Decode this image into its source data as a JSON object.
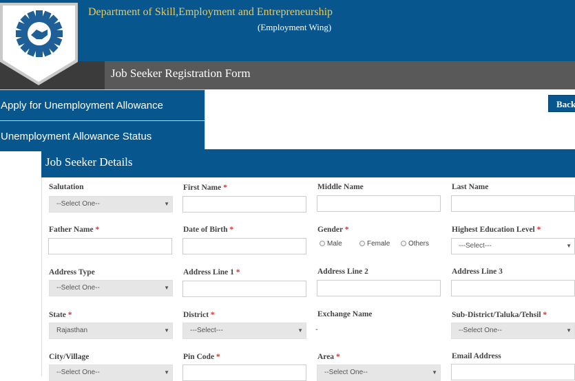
{
  "header": {
    "department": "Department of Skill,Employment and Entrepreneurship",
    "wing": "(Employment Wing)",
    "form_title": "Job Seeker Registration Form",
    "logo_icon": "gear-handshake-logo-icon"
  },
  "menu": {
    "items": [
      {
        "label": "Apply for Unemployment Allowance"
      },
      {
        "label": "Unemployment Allowance Status"
      }
    ]
  },
  "back_button": {
    "label": "Back"
  },
  "panel": {
    "title": "Job Seeker Details"
  },
  "fields": {
    "salutation": {
      "label": "Salutation",
      "value": "--Select One--"
    },
    "first_name": {
      "label": "First Name",
      "required": "*"
    },
    "middle_name": {
      "label": "Middle Name"
    },
    "last_name": {
      "label": "Last Name"
    },
    "father_name": {
      "label": "Father Name",
      "required": "*"
    },
    "dob": {
      "label": "Date of Birth",
      "required": "*"
    },
    "gender": {
      "label": "Gender",
      "required": "*",
      "options": [
        "Male",
        "Female",
        "Others"
      ]
    },
    "education": {
      "label": "Highest Education Level",
      "required": "*",
      "value": "---Select---"
    },
    "address_type": {
      "label": "Address Type",
      "value": "--Select One--"
    },
    "address_line1": {
      "label": "Address Line 1",
      "required": "*"
    },
    "address_line2": {
      "label": "Address Line 2"
    },
    "address_line3": {
      "label": "Address Line 3"
    },
    "state": {
      "label": "State",
      "required": "*",
      "value": "Rajasthan"
    },
    "district": {
      "label": "District",
      "required": "*",
      "value": "---Select---"
    },
    "exchange": {
      "label": "Exchange Name",
      "value": "-"
    },
    "subdistrict": {
      "label": "Sub-District/Taluka/Tehsil",
      "required": "*",
      "value": "--Select One--"
    },
    "city": {
      "label": "City/Village",
      "value": "--Select One--"
    },
    "pincode": {
      "label": "Pin Code",
      "required": "*"
    },
    "area": {
      "label": "Area",
      "required": "*",
      "value": "--Select One--"
    },
    "email": {
      "label": "Email Address"
    }
  },
  "colors": {
    "brand_blue": "#08568e",
    "gold": "#f2c94c",
    "required_red": "#d9302c"
  }
}
